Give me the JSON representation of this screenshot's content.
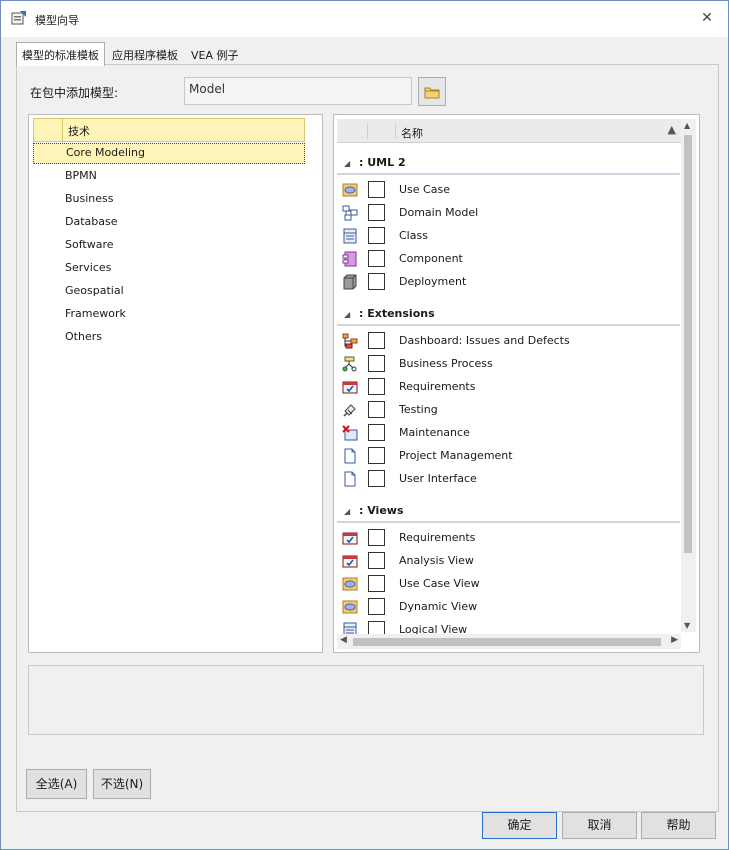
{
  "window": {
    "title": "模型向导"
  },
  "tabs": [
    {
      "label": "模型的标准模板"
    },
    {
      "label": "应用程序模板"
    },
    {
      "label": "VEA 例子"
    }
  ],
  "add_to_package": {
    "label": "在包中添加模型:",
    "value": "Model"
  },
  "technology_list": {
    "header": "技术",
    "items": [
      "Core Modeling",
      "BPMN",
      "Business",
      "Database",
      "Software",
      "Services",
      "Geospatial",
      "Framework",
      "Others"
    ],
    "selected": "Core Modeling"
  },
  "pattern_list": {
    "header_name": "名称",
    "groups": [
      {
        "label": ": UML 2",
        "items": [
          {
            "label": "Use Case",
            "icon": "use-case-icon"
          },
          {
            "label": "Domain Model",
            "icon": "domain-model-icon"
          },
          {
            "label": "Class",
            "icon": "class-icon"
          },
          {
            "label": "Component",
            "icon": "component-icon"
          },
          {
            "label": "Deployment",
            "icon": "deployment-icon"
          }
        ]
      },
      {
        "label": ": Extensions",
        "items": [
          {
            "label": "Dashboard: Issues and Defects",
            "icon": "dashboard-icon"
          },
          {
            "label": "Business Process",
            "icon": "business-process-icon"
          },
          {
            "label": "Requirements",
            "icon": "requirements-icon"
          },
          {
            "label": "Testing",
            "icon": "testing-icon"
          },
          {
            "label": "Maintenance",
            "icon": "maintenance-icon"
          },
          {
            "label": "Project Management",
            "icon": "document-icon"
          },
          {
            "label": "User Interface",
            "icon": "document-icon"
          }
        ]
      },
      {
        "label": ": Views",
        "items": [
          {
            "label": "Requirements",
            "icon": "requirements-icon"
          },
          {
            "label": "Analysis View",
            "icon": "requirements-icon"
          },
          {
            "label": "Use Case View",
            "icon": "use-case-icon"
          },
          {
            "label": "Dynamic View",
            "icon": "use-case-icon"
          },
          {
            "label": "Logical View",
            "icon": "class-icon"
          }
        ]
      }
    ]
  },
  "buttons": {
    "select_all": "全选(A)",
    "select_none": "不选(N)",
    "ok": "确定",
    "cancel": "取消",
    "help": "帮助"
  }
}
